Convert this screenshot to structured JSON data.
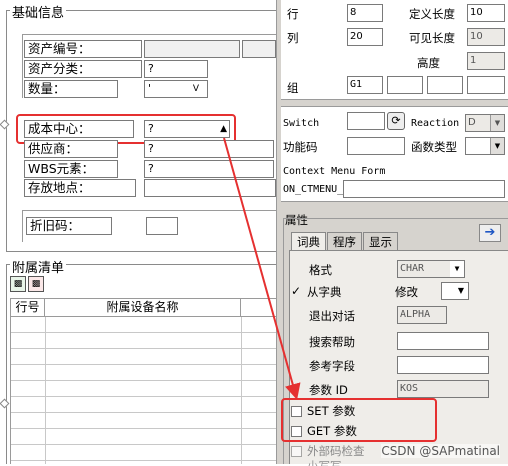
{
  "basic": {
    "title": "基础信息",
    "asset_no_label": "资产编号：",
    "asset_class_label": "资产分类：",
    "asset_class_value": "?",
    "qty_label": "数量：",
    "qty_value": "'",
    "qty_unit": "V",
    "cost_center_label": "成本中心：",
    "cost_center_value": "?",
    "supplier_label": "供应商：",
    "supplier_value": "?",
    "wbs_label": "WBS元素：",
    "wbs_value": "?",
    "location_label": "存放地点：",
    "depr_label": "折旧码："
  },
  "attach": {
    "title": "附属清单",
    "col_no": "行号",
    "col_name": "附属设备名称"
  },
  "panel": {
    "row_label": "行",
    "row_value": "8",
    "col_label": "列",
    "col_value": "20",
    "deflen_label": "定义长度",
    "deflen_value": "10",
    "vislen_label": "可见长度",
    "vislen_value": "10",
    "height_label": "高度",
    "height_value": "1",
    "group_label": "组",
    "group_value": "G1",
    "switch_label": "Switch",
    "reaction_label": "Reaction",
    "reaction_value": "D",
    "fcode_label": "功能码",
    "ftype_label": "函数类型",
    "ctx_label": "Context Menu Form",
    "ctx_value": "ON_CTMENU_",
    "attrs_title": "属性",
    "tabs": [
      "词典",
      "程序",
      "显示"
    ],
    "format_label": "格式",
    "format_value": "CHAR",
    "from_dict_label": "从字典",
    "modify_label": "修改",
    "exit_label": "退出对话",
    "exit_value": "ALPHA",
    "search_help_label": "搜索帮助",
    "ref_field_label": "参考字段",
    "param_id_label": "参数 ID",
    "param_id_value": "KOS",
    "set_param_label": "SET 参数",
    "get_param_label": "GET 参数",
    "foreign_key_label": "外部码检查",
    "upper_label": "小写写"
  },
  "watermark": "CSDN @SAPmatinal",
  "colors": {
    "highlight": "#e53030",
    "panel_bg": "#d6d3ce"
  }
}
